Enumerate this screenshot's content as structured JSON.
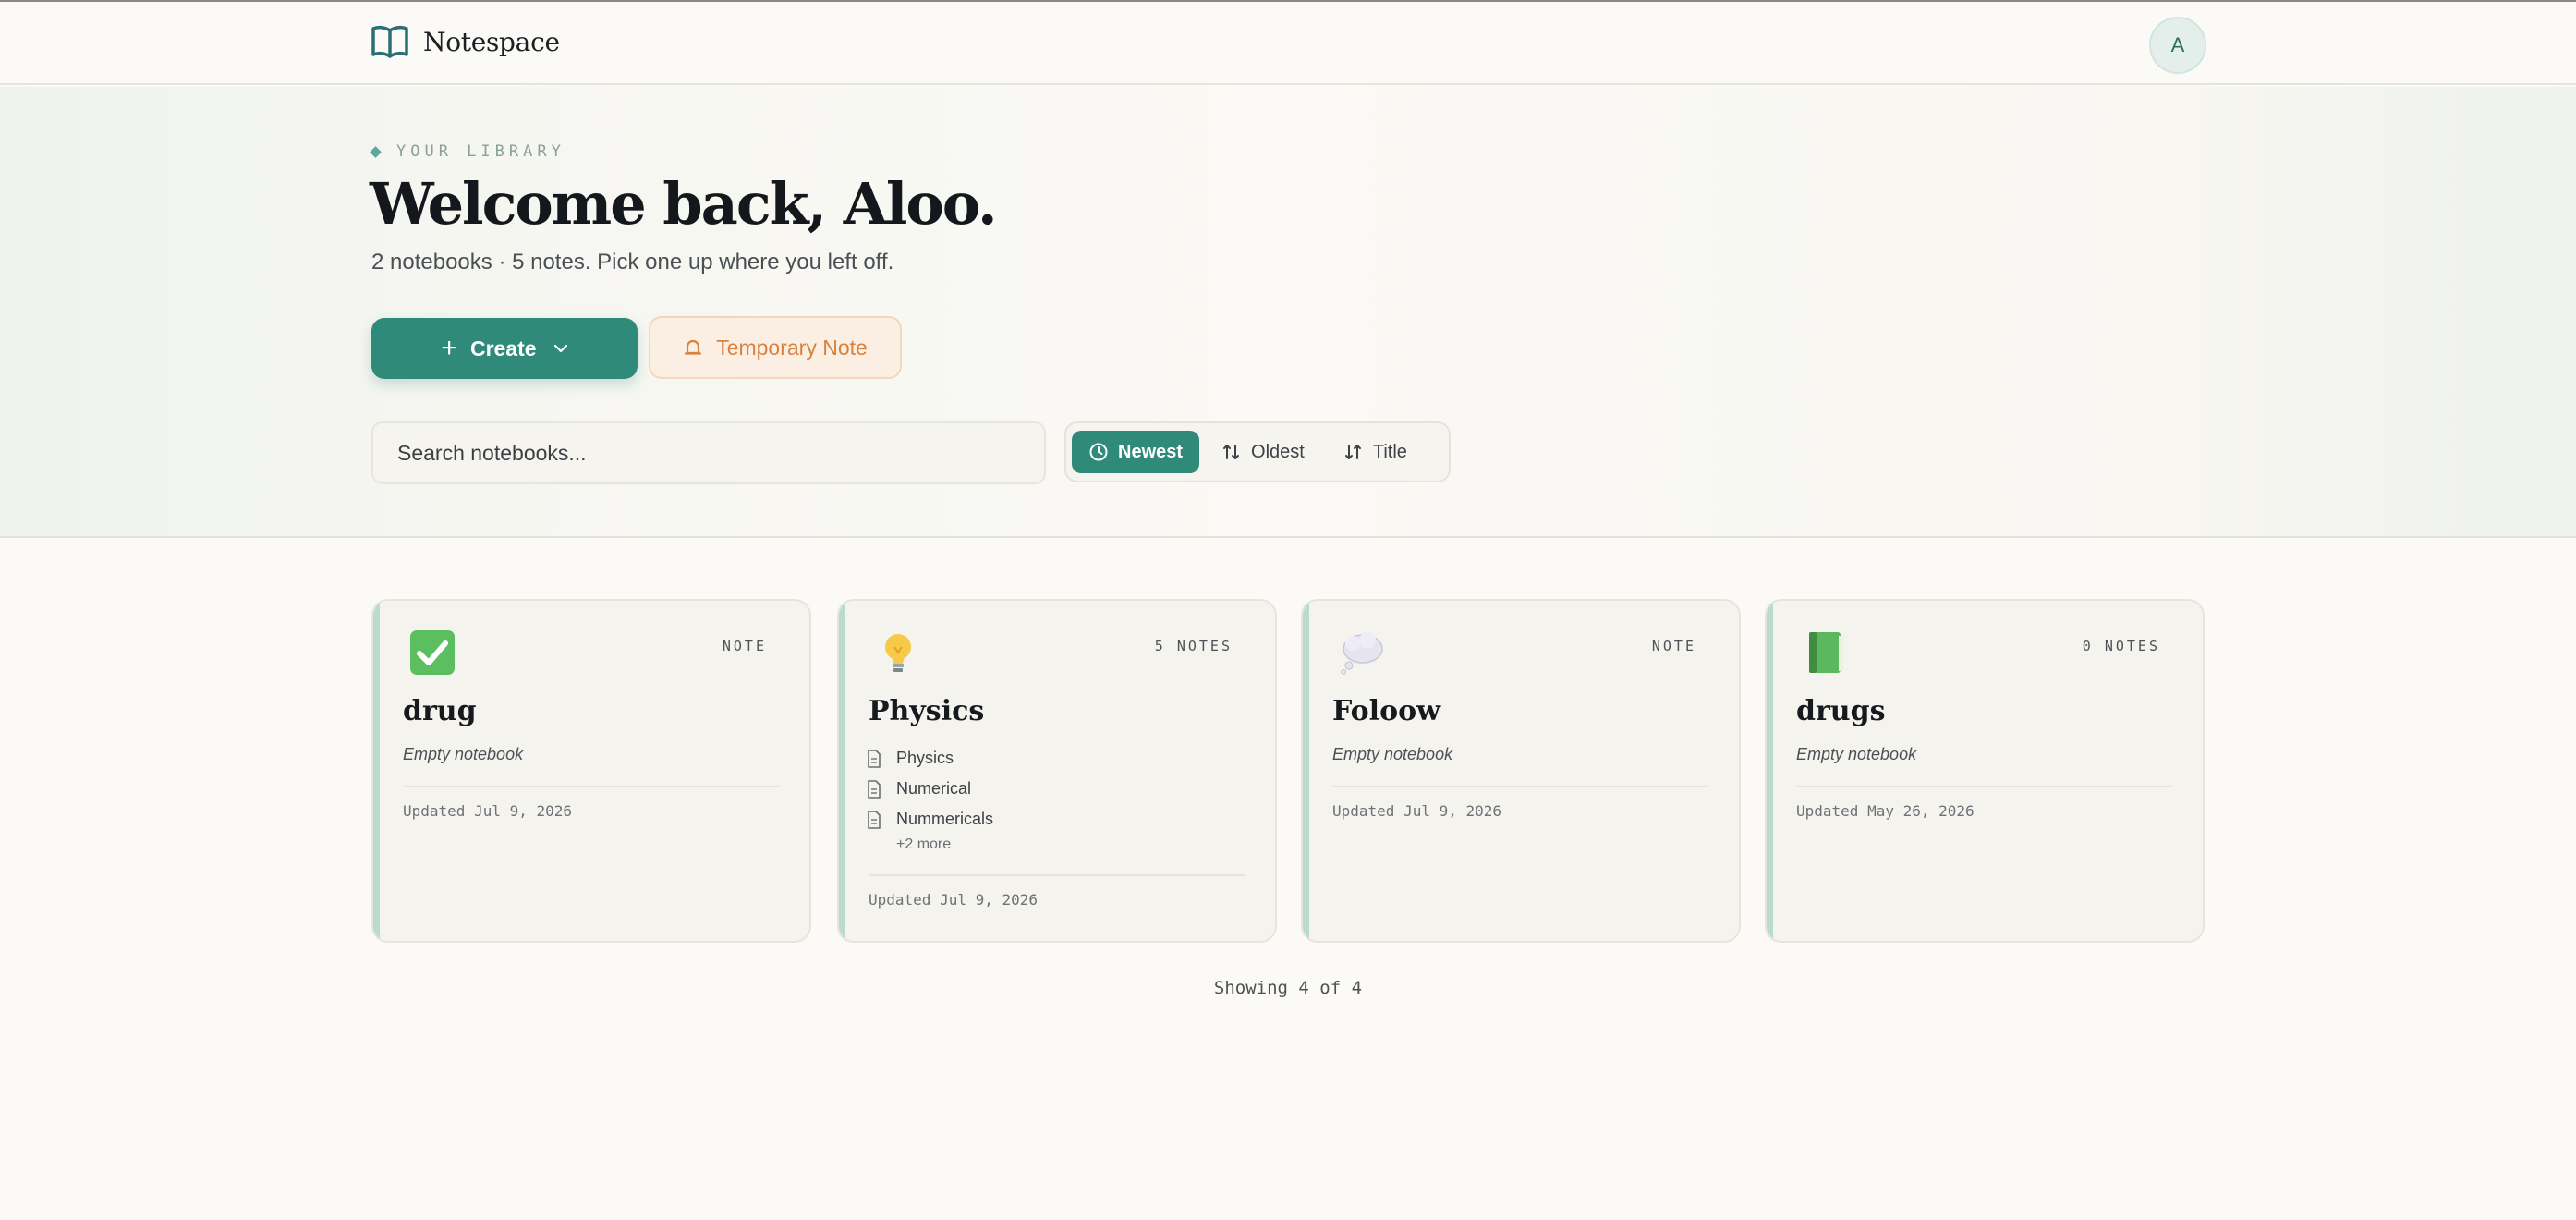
{
  "app": {
    "name": "Notespace",
    "avatar_initial": "A"
  },
  "hero": {
    "eyebrow": "YOUR LIBRARY",
    "title": "Welcome back, Aloo.",
    "subtitle": "2 notebooks · 5 notes. Pick one up where you left off.",
    "create_label": "Create",
    "temporary_label": "Temporary Note"
  },
  "search": {
    "placeholder": "Search notebooks..."
  },
  "sort": {
    "options": [
      {
        "label": "Newest",
        "icon": "clock-icon",
        "active": true
      },
      {
        "label": "Oldest",
        "icon": "sort-asc-icon",
        "active": false
      },
      {
        "label": "Title",
        "icon": "sort-desc-icon",
        "active": false
      }
    ]
  },
  "cards": [
    {
      "title": "drug",
      "badge": "NOTE",
      "icon": "check-mark-icon",
      "empty": "Empty notebook",
      "updated": "Updated Jul 9, 2026",
      "notes": []
    },
    {
      "title": "Physics",
      "badge": "5 NOTES",
      "icon": "light-bulb-icon",
      "empty": "",
      "updated": "Updated Jul 9, 2026",
      "notes": [
        "Physics",
        "Numerical",
        "Nummericals"
      ],
      "more": "+2 more"
    },
    {
      "title": "Foloow",
      "badge": "NOTE",
      "icon": "thought-bubble-icon",
      "empty": "Empty notebook",
      "updated": "Updated Jul 9, 2026",
      "notes": []
    },
    {
      "title": "drugs",
      "badge": "0 NOTES",
      "icon": "green-book-icon",
      "empty": "Empty notebook",
      "updated": "Updated May 26, 2026",
      "notes": []
    }
  ],
  "footer": {
    "count_text": "Showing 4 of 4"
  },
  "colors": {
    "accent": "#2f8a7a",
    "temporary": "#d9823f",
    "background": "#fbfaf6"
  }
}
